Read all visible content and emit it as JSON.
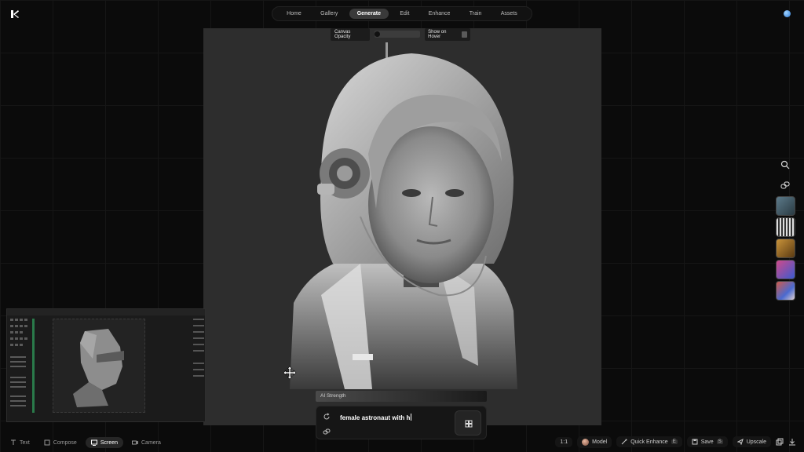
{
  "nav": {
    "tabs": [
      {
        "label": "Home"
      },
      {
        "label": "Gallery"
      },
      {
        "label": "Generate"
      },
      {
        "label": "Edit"
      },
      {
        "label": "Enhance"
      },
      {
        "label": "Train"
      },
      {
        "label": "Assets"
      }
    ],
    "active": "Generate"
  },
  "canvas_options": {
    "opacity_label": "Canvas Opacity",
    "hover_label": "Show on Hover"
  },
  "prompt": {
    "strength_label": "AI Strength",
    "text": "female astronaut with h"
  },
  "capture_modes": [
    {
      "label": "Text"
    },
    {
      "label": "Compose"
    },
    {
      "label": "Screen"
    },
    {
      "label": "Camera"
    }
  ],
  "actions": {
    "ratio": "1:1",
    "model": "Model",
    "quick_enhance": "Quick Enhance",
    "quick_enhance_key": "E",
    "save": "Save",
    "save_key": "S",
    "upscale": "Upscale"
  },
  "icons": [
    "krea-logo",
    "search-icon",
    "link-icon",
    "move-icon",
    "refresh-icon",
    "generate-icon"
  ],
  "colors": {
    "background": "#0b0b0b",
    "canvas": "#2d2d2d",
    "accent": "#2e7bd6"
  }
}
